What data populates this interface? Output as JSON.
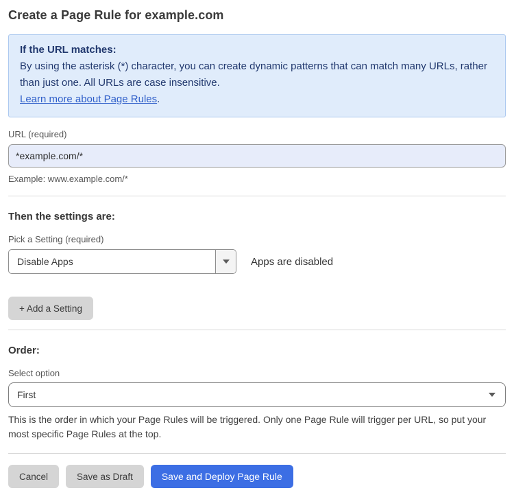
{
  "page": {
    "title": "Create a Page Rule for example.com"
  },
  "info_box": {
    "heading": "If the URL matches:",
    "body": "By using the asterisk (*) character, you can create dynamic patterns that can match many URLs, rather than just one. All URLs are case insensitive.",
    "link_label": "Learn more about Page Rules",
    "link_suffix": "."
  },
  "url_field": {
    "label": "URL (required)",
    "value": "*example.com/*",
    "example": "Example: www.example.com/*"
  },
  "settings_section": {
    "heading": "Then the settings are:",
    "picker_label": "Pick a Setting (required)",
    "selected_setting": "Disable Apps",
    "setting_status": "Apps are disabled",
    "add_setting_label": "+ Add a Setting"
  },
  "order_section": {
    "heading": "Order:",
    "select_label": "Select option",
    "selected_option": "First",
    "help_text": "This is the order in which your Page Rules will be triggered. Only one Page Rule will trigger per URL, so put your most specific Page Rules at the top."
  },
  "actions": {
    "cancel": "Cancel",
    "save_draft": "Save as Draft",
    "save_deploy": "Save and Deploy Page Rule"
  },
  "icons": {
    "dropdown_caret": "caret-down"
  },
  "colors": {
    "accent_blue": "#3c6ee4",
    "info_box_bg": "#e0ecfb",
    "info_box_border": "#abc8ef",
    "info_box_text": "#21386e",
    "link_blue": "#2e5ec9",
    "url_input_bg": "#e7ecfa",
    "gray_button_bg": "#d5d5d5",
    "divider": "#d9d9d9"
  }
}
